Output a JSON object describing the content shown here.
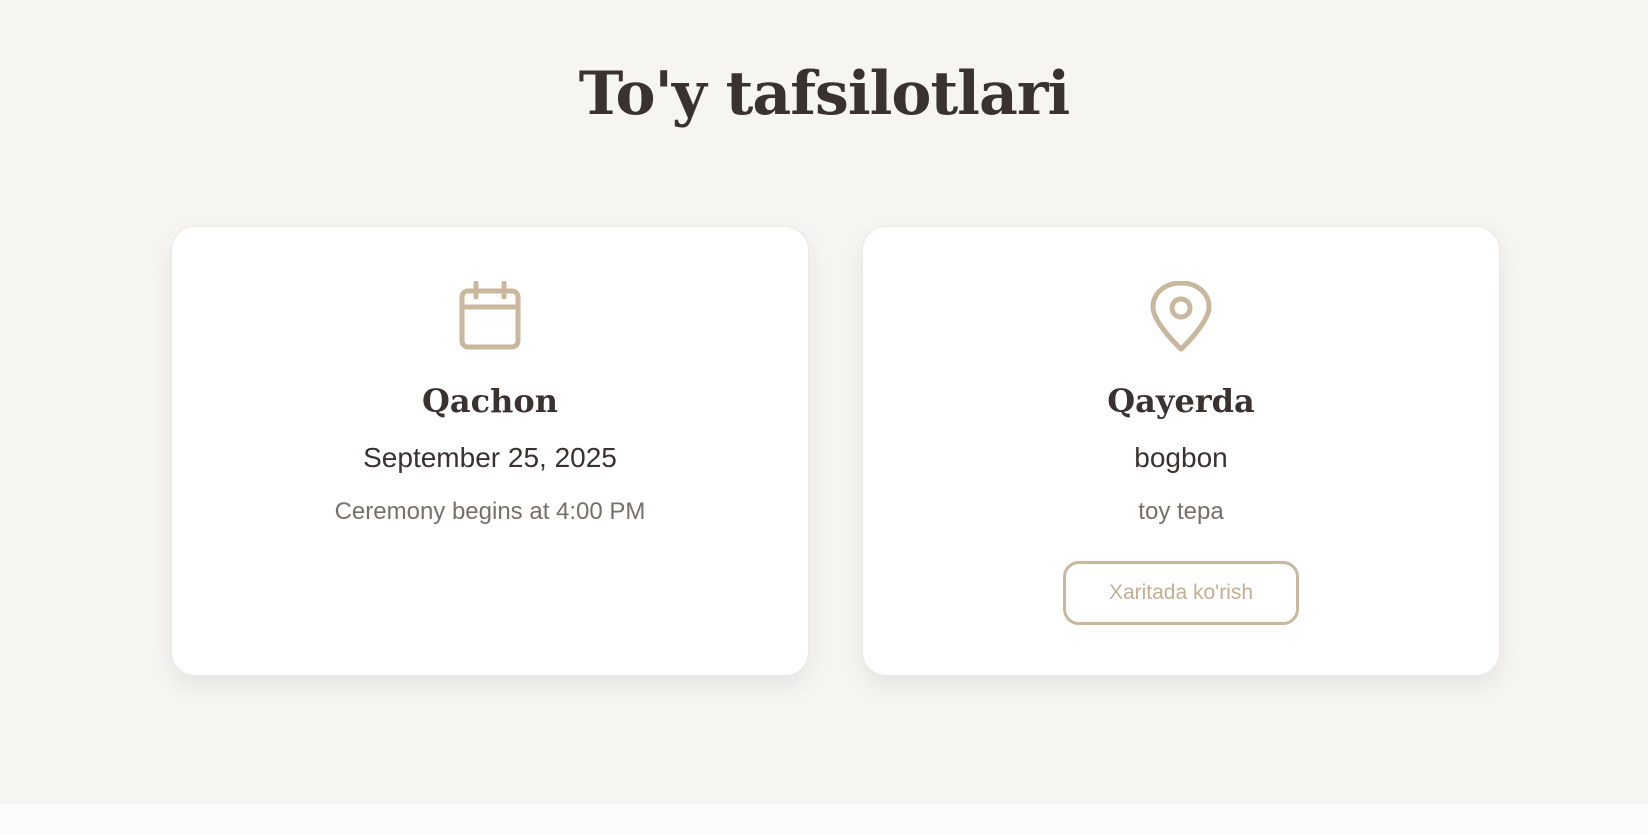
{
  "section": {
    "title": "To'y tafsilotlari"
  },
  "when_card": {
    "icon": "calendar-icon",
    "heading": "Qachon",
    "date": "September 25, 2025",
    "time_note": "Ceremony begins at 4:00 PM"
  },
  "where_card": {
    "icon": "map-pin-icon",
    "heading": "Qayerda",
    "venue": "bogbon",
    "address": "toy tepa",
    "map_button_label": "Xaritada ko'rish"
  },
  "colors": {
    "background": "#f7f5f2",
    "accent": "#c9b79e",
    "heading_text": "#3a3230",
    "muted_text": "#76706b"
  }
}
